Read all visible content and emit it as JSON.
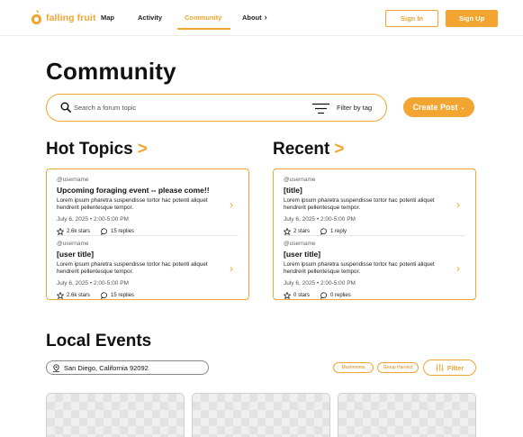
{
  "brand": {
    "name": "falling fruit",
    "accent": "#f2a531"
  },
  "nav": {
    "links": [
      "Map",
      "Activity",
      "Community",
      "About"
    ],
    "active": "Community",
    "sign_in": "Sign In",
    "sign_up": "Sign Up"
  },
  "page": {
    "title": "Community"
  },
  "search": {
    "placeholder": "Search a forum topic",
    "filter_label": "Filter by tag"
  },
  "create_post": {
    "label": "Create Post"
  },
  "hot_topics": {
    "title": "Hot Topics",
    "posts": [
      {
        "user": "@username",
        "title": "Upcoming foraging event -- please come!!",
        "body": "Lorem ipsum pharetra suspendisse tortor hac potenti aliquet hendrerit pellentesque tempor.",
        "date": "July 6, 2025 • 2:00-5:00 PM",
        "stars": "2.6k stars",
        "replies": "15 replies"
      },
      {
        "user": "@username",
        "title": "[user title]",
        "body": "Lorem ipsum pharetra suspendisse tortor hac potenti aliquet hendrerit pellentesque tempor.",
        "date": "July 6, 2025 • 2:00-5:00 PM",
        "stars": "2.6k stars",
        "replies": "15 replies"
      }
    ]
  },
  "recent": {
    "title": "Recent",
    "posts": [
      {
        "user": "@username",
        "title": "[title]",
        "body": "Lorem ipsum pharetra suspendisse tortor hac potenti aliquet hendrerit pellentesque tempor.",
        "date": "July 6, 2025 • 2:00-5:00 PM",
        "stars": "2 stars",
        "replies": "1 reply"
      },
      {
        "user": "@username",
        "title": "[user title]",
        "body": "Lorem ipsum pharetra suspendisse tortor hac potenti aliquet hendrerit pellentesque tempor.",
        "date": "July 6, 2025 • 2:00-5:00 PM",
        "stars": "0 stars",
        "replies": "0 replies"
      }
    ]
  },
  "local_events": {
    "title": "Local Events",
    "location": "San Diego, California 92092",
    "tags": [
      "Mushrooms",
      "Group Harvest"
    ],
    "filter_label": "Filter"
  }
}
